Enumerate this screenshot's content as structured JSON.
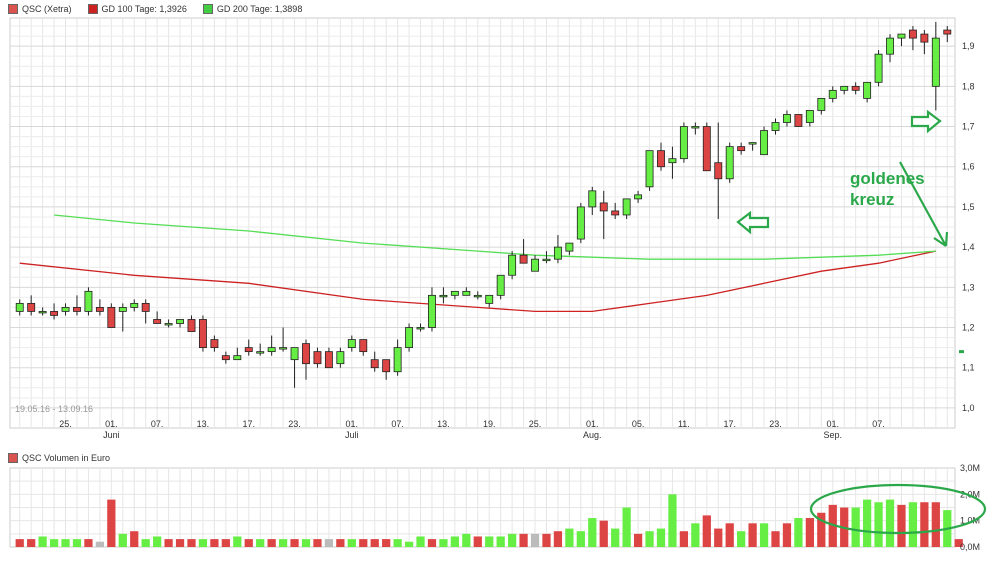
{
  "legend_top": [
    {
      "label": "QSC (Xetra)",
      "color": "#d9534f"
    },
    {
      "label": "GD 100 Tage: 1,3926",
      "color": "#cc2222"
    },
    {
      "label": "GD 200 Tage: 1,3898",
      "color": "#44cc44"
    }
  ],
  "legend_bottom": {
    "label": "QSC Volumen in Euro",
    "color": "#d9534f"
  },
  "date_range": "19.05.16 - 13.09.16",
  "annotation": {
    "line1": "goldenes",
    "line2": "kreuz",
    "color": "#2aa84a"
  },
  "colors": {
    "up": "#66ee44",
    "down": "#dd4444",
    "neutral": "#bbbbbb",
    "ma100": "#cc2222",
    "ma200": "#55dd55",
    "annotation": "#2aa84a"
  },
  "chart_data": [
    {
      "type": "candlestick",
      "ylim": [
        0.95,
        1.97
      ],
      "y_ticks": [
        "1,0",
        "1,1",
        "1,2",
        "1,3",
        "1,4",
        "1,5",
        "1,6",
        "1,7",
        "1,8",
        "1,9"
      ],
      "x_ticks": [
        {
          "label": "25.",
          "sub": ""
        },
        {
          "label": "01.",
          "sub": "Juni"
        },
        {
          "label": "07.",
          "sub": ""
        },
        {
          "label": "13.",
          "sub": ""
        },
        {
          "label": "17.",
          "sub": ""
        },
        {
          "label": "23.",
          "sub": ""
        },
        {
          "label": "01.",
          "sub": "Juli"
        },
        {
          "label": "07.",
          "sub": ""
        },
        {
          "label": "13.",
          "sub": ""
        },
        {
          "label": "19.",
          "sub": ""
        },
        {
          "label": "25.",
          "sub": ""
        },
        {
          "label": "01.",
          "sub": "Aug."
        },
        {
          "label": "05.",
          "sub": ""
        },
        {
          "label": "11.",
          "sub": ""
        },
        {
          "label": "17.",
          "sub": ""
        },
        {
          "label": "23.",
          "sub": ""
        },
        {
          "label": "01.",
          "sub": "Sep."
        },
        {
          "label": "07.",
          "sub": ""
        }
      ],
      "x_tick_index": [
        4,
        8,
        12,
        16,
        20,
        24,
        29,
        33,
        37,
        41,
        45,
        50,
        54,
        58,
        62,
        66,
        71,
        75
      ],
      "last_marker": 1.14,
      "ohlc": [
        [
          1.24,
          1.27,
          1.23,
          1.26
        ],
        [
          1.26,
          1.28,
          1.23,
          1.24
        ],
        [
          1.24,
          1.25,
          1.23,
          1.24
        ],
        [
          1.24,
          1.26,
          1.22,
          1.23
        ],
        [
          1.24,
          1.26,
          1.23,
          1.25
        ],
        [
          1.25,
          1.28,
          1.23,
          1.24
        ],
        [
          1.24,
          1.3,
          1.23,
          1.29
        ],
        [
          1.25,
          1.27,
          1.23,
          1.24
        ],
        [
          1.25,
          1.26,
          1.2,
          1.2
        ],
        [
          1.24,
          1.26,
          1.19,
          1.25
        ],
        [
          1.25,
          1.27,
          1.24,
          1.26
        ],
        [
          1.26,
          1.27,
          1.21,
          1.24
        ],
        [
          1.22,
          1.24,
          1.21,
          1.21
        ],
        [
          1.21,
          1.22,
          1.2,
          1.21
        ],
        [
          1.21,
          1.22,
          1.2,
          1.22
        ],
        [
          1.22,
          1.23,
          1.19,
          1.19
        ],
        [
          1.22,
          1.23,
          1.14,
          1.15
        ],
        [
          1.17,
          1.18,
          1.14,
          1.15
        ],
        [
          1.13,
          1.14,
          1.11,
          1.12
        ],
        [
          1.12,
          1.15,
          1.12,
          1.13
        ],
        [
          1.15,
          1.17,
          1.13,
          1.14
        ],
        [
          1.14,
          1.16,
          1.13,
          1.14
        ],
        [
          1.14,
          1.18,
          1.13,
          1.15
        ],
        [
          1.15,
          1.2,
          1.14,
          1.15
        ],
        [
          1.12,
          1.15,
          1.05,
          1.15
        ],
        [
          1.16,
          1.17,
          1.07,
          1.11
        ],
        [
          1.14,
          1.15,
          1.1,
          1.11
        ],
        [
          1.14,
          1.15,
          1.1,
          1.1
        ],
        [
          1.11,
          1.15,
          1.1,
          1.14
        ],
        [
          1.15,
          1.18,
          1.14,
          1.17
        ],
        [
          1.17,
          1.17,
          1.13,
          1.14
        ],
        [
          1.12,
          1.14,
          1.09,
          1.1
        ],
        [
          1.12,
          1.12,
          1.07,
          1.09
        ],
        [
          1.09,
          1.17,
          1.08,
          1.15
        ],
        [
          1.15,
          1.21,
          1.14,
          1.2
        ],
        [
          1.2,
          1.21,
          1.19,
          1.2
        ],
        [
          1.2,
          1.3,
          1.19,
          1.28
        ],
        [
          1.28,
          1.3,
          1.26,
          1.28
        ],
        [
          1.28,
          1.29,
          1.27,
          1.29
        ],
        [
          1.28,
          1.3,
          1.28,
          1.29
        ],
        [
          1.28,
          1.29,
          1.27,
          1.28
        ],
        [
          1.26,
          1.28,
          1.25,
          1.28
        ],
        [
          1.28,
          1.3,
          1.27,
          1.33
        ],
        [
          1.33,
          1.39,
          1.32,
          1.38
        ],
        [
          1.38,
          1.42,
          1.36,
          1.36
        ],
        [
          1.34,
          1.38,
          1.34,
          1.37
        ],
        [
          1.37,
          1.39,
          1.36,
          1.37
        ],
        [
          1.37,
          1.43,
          1.36,
          1.4
        ],
        [
          1.39,
          1.41,
          1.38,
          1.41
        ],
        [
          1.42,
          1.51,
          1.41,
          1.5
        ],
        [
          1.5,
          1.55,
          1.48,
          1.54
        ],
        [
          1.51,
          1.54,
          1.42,
          1.49
        ],
        [
          1.49,
          1.51,
          1.47,
          1.48
        ],
        [
          1.48,
          1.52,
          1.47,
          1.52
        ],
        [
          1.52,
          1.54,
          1.51,
          1.53
        ],
        [
          1.55,
          1.64,
          1.54,
          1.64
        ],
        [
          1.64,
          1.66,
          1.59,
          1.6
        ],
        [
          1.61,
          1.65,
          1.57,
          1.62
        ],
        [
          1.62,
          1.71,
          1.61,
          1.7
        ],
        [
          1.7,
          1.71,
          1.68,
          1.7
        ],
        [
          1.7,
          1.71,
          1.61,
          1.59
        ],
        [
          1.61,
          1.71,
          1.47,
          1.57
        ],
        [
          1.57,
          1.66,
          1.56,
          1.65
        ],
        [
          1.65,
          1.66,
          1.63,
          1.64
        ],
        [
          1.66,
          1.66,
          1.64,
          1.66
        ],
        [
          1.63,
          1.7,
          1.63,
          1.69
        ],
        [
          1.69,
          1.72,
          1.68,
          1.71
        ],
        [
          1.71,
          1.74,
          1.7,
          1.73
        ],
        [
          1.73,
          1.73,
          1.7,
          1.7
        ],
        [
          1.71,
          1.74,
          1.7,
          1.74
        ],
        [
          1.74,
          1.77,
          1.73,
          1.77
        ],
        [
          1.77,
          1.8,
          1.76,
          1.79
        ],
        [
          1.79,
          1.8,
          1.78,
          1.8
        ],
        [
          1.8,
          1.81,
          1.78,
          1.79
        ],
        [
          1.77,
          1.81,
          1.76,
          1.81
        ],
        [
          1.81,
          1.89,
          1.8,
          1.88
        ],
        [
          1.88,
          1.93,
          1.86,
          1.92
        ],
        [
          1.92,
          1.93,
          1.9,
          1.93
        ],
        [
          1.94,
          1.95,
          1.89,
          1.92
        ],
        [
          1.93,
          1.94,
          1.88,
          1.91
        ],
        [
          1.8,
          1.96,
          1.74,
          1.92
        ],
        [
          1.94,
          1.95,
          1.91,
          1.93
        ]
      ],
      "ma100": [
        [
          0,
          1.36
        ],
        [
          10,
          1.33
        ],
        [
          20,
          1.31
        ],
        [
          30,
          1.27
        ],
        [
          40,
          1.25
        ],
        [
          45,
          1.24
        ],
        [
          50,
          1.24
        ],
        [
          55,
          1.26
        ],
        [
          60,
          1.28
        ],
        [
          65,
          1.31
        ],
        [
          70,
          1.34
        ],
        [
          75,
          1.36
        ],
        [
          80,
          1.39
        ]
      ],
      "ma200": [
        [
          3,
          1.48
        ],
        [
          10,
          1.46
        ],
        [
          20,
          1.44
        ],
        [
          30,
          1.41
        ],
        [
          40,
          1.39
        ],
        [
          45,
          1.38
        ],
        [
          50,
          1.375
        ],
        [
          55,
          1.37
        ],
        [
          60,
          1.37
        ],
        [
          65,
          1.37
        ],
        [
          70,
          1.375
        ],
        [
          75,
          1.38
        ],
        [
          80,
          1.39
        ]
      ]
    },
    {
      "type": "bar",
      "title": "QSC Volumen in Euro",
      "ylim": [
        0,
        3.0
      ],
      "y_ticks": [
        "3,0M",
        "2,0M",
        "1,0M",
        "0,0M"
      ],
      "values": [
        0.3,
        0.3,
        0.4,
        0.3,
        0.3,
        0.3,
        0.3,
        0.2,
        1.8,
        0.5,
        0.6,
        0.3,
        0.4,
        0.3,
        0.3,
        0.3,
        0.3,
        0.3,
        0.3,
        0.4,
        0.3,
        0.3,
        0.3,
        0.3,
        0.3,
        0.3,
        0.3,
        0.3,
        0.3,
        0.3,
        0.3,
        0.3,
        0.3,
        0.3,
        0.2,
        0.4,
        0.3,
        0.3,
        0.4,
        0.5,
        0.4,
        0.4,
        0.4,
        0.5,
        0.5,
        0.5,
        0.5,
        0.6,
        0.7,
        0.6,
        1.1,
        1.0,
        0.7,
        1.5,
        0.5,
        0.6,
        0.7,
        2.0,
        0.6,
        0.9,
        1.2,
        0.7,
        0.9,
        0.6,
        0.9,
        0.9,
        0.6,
        0.9,
        1.1,
        1.1,
        1.3,
        1.6,
        1.5,
        1.5,
        1.8,
        1.7,
        1.8,
        1.6,
        1.7,
        1.7,
        1.7,
        1.4,
        0.3
      ],
      "colors_seq": [
        "d",
        "d",
        "u",
        "u",
        "u",
        "u",
        "d",
        "n",
        "d",
        "u",
        "d",
        "u",
        "u",
        "d",
        "d",
        "d",
        "u",
        "d",
        "d",
        "u",
        "d",
        "u",
        "d",
        "u",
        "d",
        "u",
        "d",
        "n",
        "d",
        "u",
        "d",
        "d",
        "d",
        "u",
        "u",
        "u",
        "d",
        "u",
        "u",
        "u",
        "d",
        "u",
        "u",
        "u",
        "d",
        "n",
        "d",
        "d",
        "u",
        "u",
        "u",
        "d",
        "u",
        "u",
        "d",
        "u",
        "u",
        "u",
        "d",
        "u",
        "d",
        "d",
        "d",
        "u",
        "d",
        "u",
        "d",
        "d",
        "u",
        "d",
        "d",
        "d",
        "d",
        "u",
        "u",
        "u",
        "u",
        "d",
        "u",
        "d",
        "d",
        "u",
        "d"
      ]
    }
  ]
}
